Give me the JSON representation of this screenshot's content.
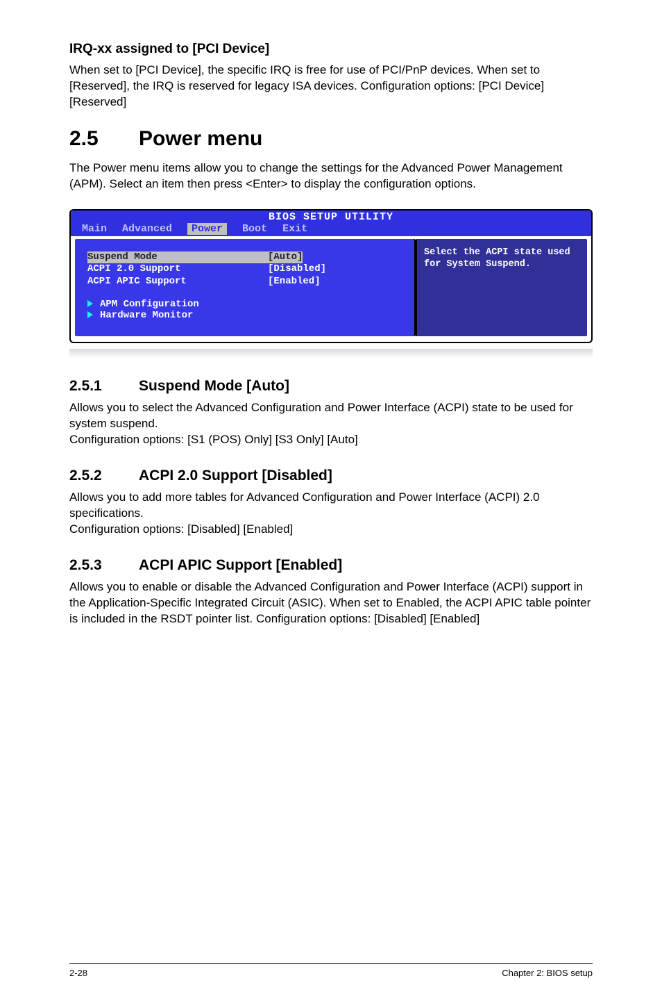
{
  "section_irq": {
    "heading": "IRQ-xx assigned to [PCI Device]",
    "body": "When set to [PCI Device], the specific IRQ is free for use of PCI/PnP devices. When set to [Reserved], the IRQ is reserved for legacy ISA devices. Configuration options: [PCI Device] [Reserved]"
  },
  "section_power": {
    "number": "2.5",
    "title": "Power menu",
    "intro": "The Power menu items allow you to change the settings for the Advanced Power Management (APM). Select an item then press <Enter> to display the configuration options."
  },
  "bios": {
    "title": "BIOS SETUP UTILITY",
    "tabs": [
      "Main",
      "Advanced",
      "Power",
      "Boot",
      "Exit"
    ],
    "selected_tab": "Power",
    "rows": [
      {
        "label": "Suspend Mode",
        "value": "[Auto]",
        "selected": true
      },
      {
        "label": "ACPI 2.0 Support",
        "value": "[Disabled]",
        "selected": false
      },
      {
        "label": "ACPI APIC Support",
        "value": "[Enabled]",
        "selected": false
      }
    ],
    "subitems": [
      "APM Configuration",
      "Hardware Monitor"
    ],
    "help": "Select the ACPI state used for System Suspend."
  },
  "sub_251": {
    "number": "2.5.1",
    "title": "Suspend Mode [Auto]",
    "body": "Allows you to select the Advanced Configuration and Power Interface (ACPI) state to be used for system suspend.\nConfiguration options: [S1 (POS) Only] [S3 Only] [Auto]"
  },
  "sub_252": {
    "number": "2.5.2",
    "title": "ACPI 2.0 Support [Disabled]",
    "body": "Allows you to add more tables for Advanced Configuration and Power Interface (ACPI) 2.0 specifications.\nConfiguration options: [Disabled] [Enabled]"
  },
  "sub_253": {
    "number": "2.5.3",
    "title": "ACPI APIC Support [Enabled]",
    "body": "Allows you to enable or disable the Advanced Configuration and Power Interface (ACPI) support in the Application-Specific Integrated Circuit (ASIC). When set to Enabled, the ACPI APIC table pointer is included in the RSDT pointer list. Configuration options: [Disabled] [Enabled]"
  },
  "footer": {
    "left": "2-28",
    "right": "Chapter 2: BIOS setup"
  }
}
